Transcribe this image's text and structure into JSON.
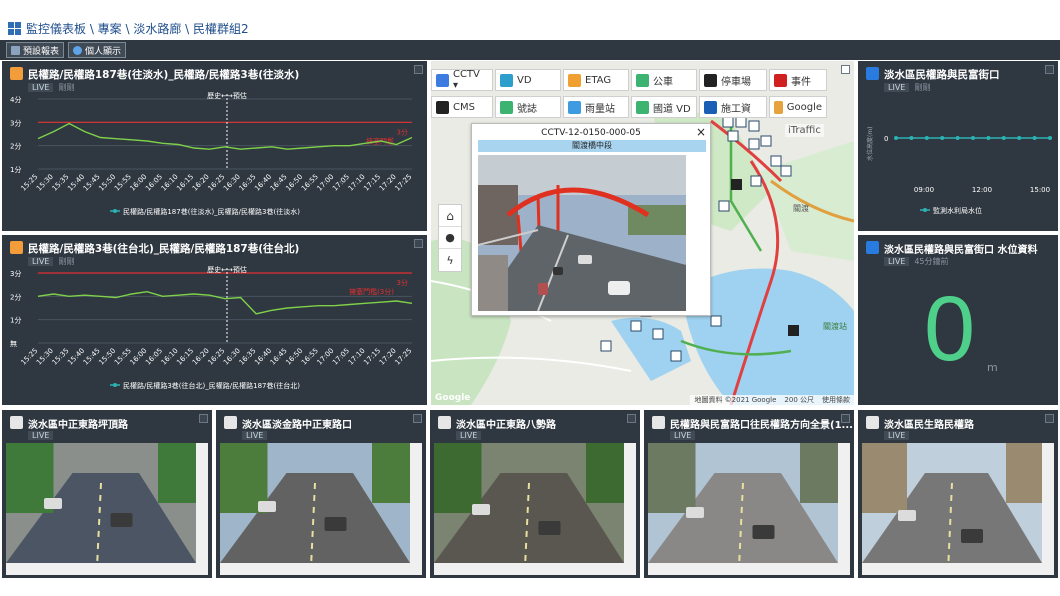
{
  "breadcrumb": "監控儀表板 \\ 專案 \\ 淡水路廊 \\ 民權群組2",
  "toolbar": {
    "preset_label": "預設報表",
    "personal_label": "個人顯示"
  },
  "chart1": {
    "title": "民權路/民權路187巷(往淡水)_民權路/民權路3巷(往淡水)",
    "live": "LIVE",
    "status": "剛剛",
    "history_label": "歷史←→預估",
    "threshold_label": "擁塞門檻",
    "threshold_value": "3分",
    "legend": "民權路/民權路187巷(往淡水)_民權路/民權路3巷(往淡水)"
  },
  "chart2": {
    "title": "民權路/民權路3巷(往台北)_民權路/民權路187巷(往台北)",
    "live": "LIVE",
    "status": "剛剛",
    "history_label": "歷史←→預估",
    "threshold_label": "擁塞門檻(3分)",
    "threshold_value": "3分",
    "legend": "民權路/民權路3巷(往台北)_民權路/民權路187巷(往台北)"
  },
  "chart_data": [
    {
      "type": "line",
      "title": "民權路/民權路187巷(往淡水)_民權路/民權路3巷(往淡水)",
      "ylabel": "",
      "xlabel": "",
      "ylim": [
        1,
        4
      ],
      "yticks": [
        "1分",
        "2分",
        "3分",
        "4分"
      ],
      "categories": [
        "15:25",
        "15:30",
        "15:35",
        "15:40",
        "15:45",
        "15:50",
        "15:55",
        "16:00",
        "16:05",
        "16:10",
        "16:15",
        "16:20",
        "16:25",
        "16:30",
        "16:35",
        "16:40",
        "16:45",
        "16:50",
        "16:55",
        "17:00",
        "17:05",
        "17:10",
        "17:15",
        "17:20",
        "17:25"
      ],
      "series": [
        {
          "name": "民權路/民權路187巷(往淡水)_民權路/民權路3巷(往淡水)",
          "color": "#7fd14a",
          "values": [
            2.3,
            2.6,
            2.95,
            2.6,
            2.35,
            2.3,
            2.25,
            2.2,
            2.1,
            2.05,
            1.9,
            1.85,
            1.95,
            1.85,
            1.9,
            1.95,
            1.85,
            1.9,
            1.95,
            2.0,
            2.0,
            2.1,
            2.2,
            2.05,
            2.35
          ]
        }
      ],
      "threshold": 3,
      "threshold_color": "#e03030",
      "grid": true,
      "legend": "bottom"
    },
    {
      "type": "line",
      "title": "民權路/民權路3巷(往台北)_民權路/民權路187巷(往台北)",
      "ylabel": "",
      "xlabel": "",
      "ylim": [
        0,
        3
      ],
      "yticks": [
        "無",
        "1分",
        "2分",
        "3分"
      ],
      "categories": [
        "15:25",
        "15:30",
        "15:35",
        "15:40",
        "15:45",
        "15:50",
        "15:55",
        "16:00",
        "16:05",
        "16:10",
        "16:15",
        "16:20",
        "16:25",
        "16:30",
        "16:35",
        "16:40",
        "16:45",
        "16:50",
        "16:55",
        "17:00",
        "17:05",
        "17:10",
        "17:15",
        "17:20",
        "17:25"
      ],
      "series": [
        {
          "name": "民權路/民權路3巷(往台北)_民權路/民權路187巷(往台北)",
          "color": "#7fd14a",
          "values": [
            2.0,
            2.1,
            2.0,
            2.05,
            2.0,
            1.95,
            2.1,
            2.2,
            2.0,
            2.05,
            2.1,
            2.05,
            1.9,
            1.95,
            1.25,
            1.4,
            1.5,
            1.55,
            1.6,
            1.6,
            1.65,
            1.7,
            1.75,
            1.8,
            1.7
          ]
        }
      ],
      "threshold": 3,
      "threshold_color": "#e03030",
      "grid": true,
      "legend": "bottom"
    },
    {
      "type": "line",
      "title": "淡水區民權路與民富街口",
      "ylabel": "水位高度(m)",
      "ylim": [
        -1,
        1
      ],
      "yticks": [
        "0"
      ],
      "categories": [
        "09:00",
        "12:00",
        "15:00"
      ],
      "series": [
        {
          "name": "監測水利局水位",
          "color": "#2bb3b3",
          "values": [
            0,
            0,
            0,
            0,
            0,
            0,
            0,
            0,
            0,
            0,
            0
          ]
        }
      ],
      "legend": "bottom"
    }
  ],
  "map": {
    "buttons_row1": [
      {
        "label": "CCTV ▾",
        "icon": "cctv-icon",
        "color": "#3d7be0"
      },
      {
        "label": "VD",
        "icon": "vd-icon",
        "color": "#2e9fcc"
      },
      {
        "label": "ETAG",
        "icon": "etag-icon",
        "color": "#f0a030"
      },
      {
        "label": "公車",
        "icon": "bus-icon",
        "color": "#3cb371"
      },
      {
        "label": "停車場",
        "icon": "parking-icon",
        "color": "#222222"
      },
      {
        "label": "事件",
        "icon": "incident-icon",
        "color": "#d02020"
      }
    ],
    "buttons_row2": [
      {
        "label": "CMS",
        "icon": "cms-icon",
        "color": "#222222"
      },
      {
        "label": "號誌",
        "icon": "signal-icon",
        "color": "#3cb371"
      },
      {
        "label": "雨量站",
        "icon": "rain-icon",
        "color": "#3d9be0"
      },
      {
        "label": "國道 VD",
        "icon": "freeway-vd-icon",
        "color": "#3cb371"
      },
      {
        "label": "施工資",
        "icon": "construction-icon",
        "color": "#1a5fb4"
      },
      {
        "label": "Google",
        "icon": "google-icon",
        "color": "#e6a23c"
      }
    ],
    "itraffic_label": "iTraffic",
    "popup": {
      "id": "CCTV-12-0150-000-05",
      "name": "關渡橋中段",
      "close": "×"
    },
    "labels": [
      "關渡",
      "關渡站"
    ],
    "footer_google": "Google",
    "footer_attrib": "地圖資料 ©2021 Google",
    "footer_scale": "200 公尺",
    "footer_terms": "使用條款"
  },
  "water1": {
    "title": "淡水區民權路與民富街口",
    "live": "LIVE",
    "status": "剛剛",
    "legend": "監測水利局水位",
    "ylabel": "水位高度(m)",
    "zero": "0"
  },
  "water2": {
    "title": "淡水區民權路與民富街口 水位資料",
    "live": "LIVE",
    "status": "45分鐘前",
    "value": "0",
    "unit": "m"
  },
  "cams": [
    {
      "title": "淡水區中正東路坪頂路",
      "live": "LIVE"
    },
    {
      "title": "淡水區淡金路中正東路口",
      "live": "LIVE"
    },
    {
      "title": "淡水區中正東路八勢路",
      "live": "LIVE"
    },
    {
      "title": "民權路與民富路口往民權路方向全景(1...",
      "live": "LIVE"
    },
    {
      "title": "淡水區民生路民權路",
      "live": "LIVE"
    }
  ]
}
